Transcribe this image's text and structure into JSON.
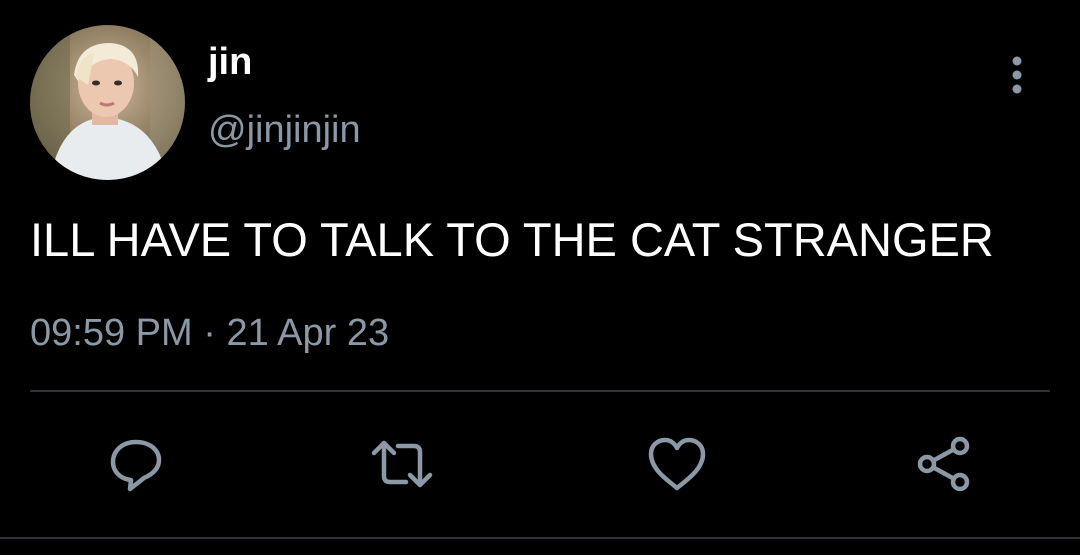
{
  "author": {
    "display_name": "jin",
    "handle": "@jinjinjin"
  },
  "tweet": {
    "text": "ILL HAVE TO TALK TO THE CAT STRANGER",
    "time": "09:59 PM",
    "separator": "·",
    "date": "21 Apr 23"
  },
  "icons": {
    "more": "more-vertical-icon",
    "reply": "reply-icon",
    "retweet": "retweet-icon",
    "like": "heart-icon",
    "share": "share-icon"
  },
  "colors": {
    "background": "#000000",
    "primary_text": "#ffffff",
    "secondary_text": "#8b98a5",
    "divider": "#2f3336"
  }
}
